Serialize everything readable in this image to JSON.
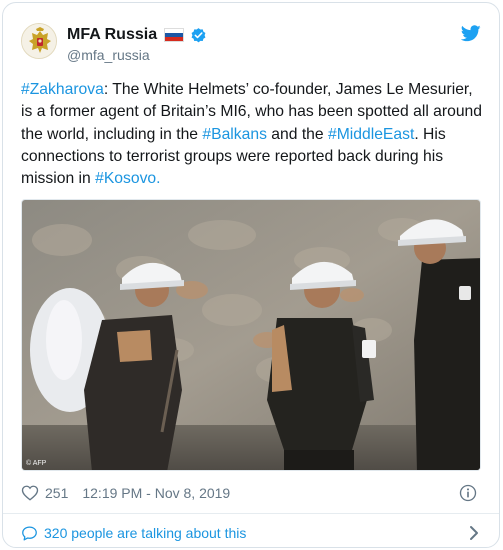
{
  "account": {
    "display_name": "MFA Russia",
    "handle": "@mfa_russia",
    "flag": "russia-flag",
    "verified": true
  },
  "tweet": {
    "segments": [
      {
        "text": "#Zakharova",
        "hashtag": true
      },
      {
        "text": ": The White Helmets’ co-founder, James Le Mesurier, is a former agent of Britain’s MI6, who has been spotted all around the world, including in the ",
        "hashtag": false
      },
      {
        "text": "#Balkans",
        "hashtag": true
      },
      {
        "text": " and the ",
        "hashtag": false
      },
      {
        "text": "#MiddleEast",
        "hashtag": true
      },
      {
        "text": ". His connections to terrorist groups were reported back during his mission in ",
        "hashtag": false
      },
      {
        "text": "#Kosovo",
        "hashtag": true
      },
      {
        "text": ".",
        "hashtag": false
      }
    ]
  },
  "photo": {
    "credit": "© AFP"
  },
  "meta": {
    "likes": "251",
    "timestamp": "12:19 PM - Nov 8, 2019"
  },
  "footer": {
    "talking": "320 people are talking about this"
  },
  "colors": {
    "link": "#1b95e0",
    "muted": "#657786",
    "text": "#14171a",
    "border": "#d9e1e8"
  }
}
